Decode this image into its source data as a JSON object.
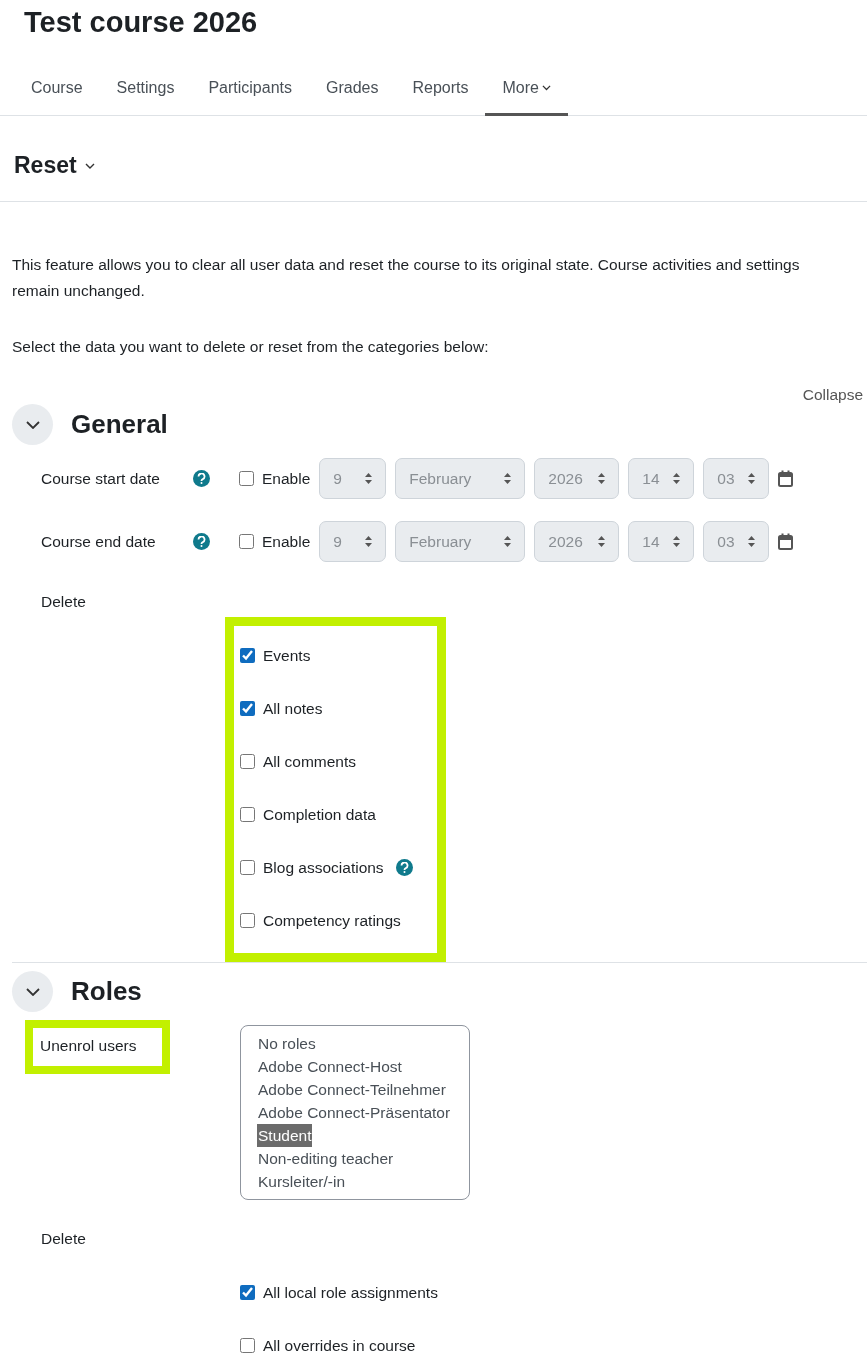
{
  "course_title": "Test course 2026",
  "tabs": [
    {
      "label": "Course",
      "selected": false,
      "dropdown": false
    },
    {
      "label": "Settings",
      "selected": false,
      "dropdown": false
    },
    {
      "label": "Participants",
      "selected": false,
      "dropdown": false
    },
    {
      "label": "Grades",
      "selected": false,
      "dropdown": false
    },
    {
      "label": "Reports",
      "selected": false,
      "dropdown": false
    },
    {
      "label": "More",
      "selected": true,
      "dropdown": true
    }
  ],
  "page_heading": "Reset",
  "intro_lines": [
    "This feature allows you to clear all user data and reset the course to its original state. Course activities and settings",
    "remain unchanged."
  ],
  "instruction": "Select the data you want to delete or reset from the categories below:",
  "collapse_link": "Collapse",
  "sections": [
    {
      "title": "General",
      "expanded": true,
      "date_fields": [
        {
          "label": "Course start date",
          "enable_label": "Enable",
          "enabled": false,
          "day": "9",
          "month": "February",
          "year": "2026",
          "hour": "14",
          "minute": "03"
        },
        {
          "label": "Course end date",
          "enable_label": "Enable",
          "enabled": false,
          "day": "9",
          "month": "February",
          "year": "2026",
          "hour": "14",
          "minute": "03"
        }
      ],
      "delete_label": "Delete",
      "delete_highlighted": true,
      "delete_options": [
        {
          "label": "Events",
          "checked": true,
          "help": false
        },
        {
          "label": "All notes",
          "checked": true,
          "help": false
        },
        {
          "label": "All comments",
          "checked": false,
          "help": false
        },
        {
          "label": "Completion data",
          "checked": false,
          "help": false
        },
        {
          "label": "Blog associations",
          "checked": false,
          "help": true
        },
        {
          "label": "Competency ratings",
          "checked": false,
          "help": false
        }
      ]
    },
    {
      "title": "Roles",
      "expanded": true,
      "unenrol": {
        "label": "Unenrol users",
        "highlighted": true,
        "options": [
          {
            "label": "No roles",
            "selected": false
          },
          {
            "label": "Adobe Connect-Host",
            "selected": false
          },
          {
            "label": "Adobe Connect-Teilnehmer",
            "selected": false
          },
          {
            "label": "Adobe Connect-Präsentator",
            "selected": false
          },
          {
            "label": "Student",
            "selected": true
          },
          {
            "label": "Non-editing teacher",
            "selected": false
          },
          {
            "label": "Kursleiter/-in",
            "selected": false
          }
        ]
      },
      "delete_label": "Delete",
      "delete_highlighted": false,
      "delete_options": [
        {
          "label": "All local role assignments",
          "checked": true,
          "help": false
        },
        {
          "label": "All overrides in course",
          "checked": false,
          "help": false
        }
      ]
    }
  ]
}
